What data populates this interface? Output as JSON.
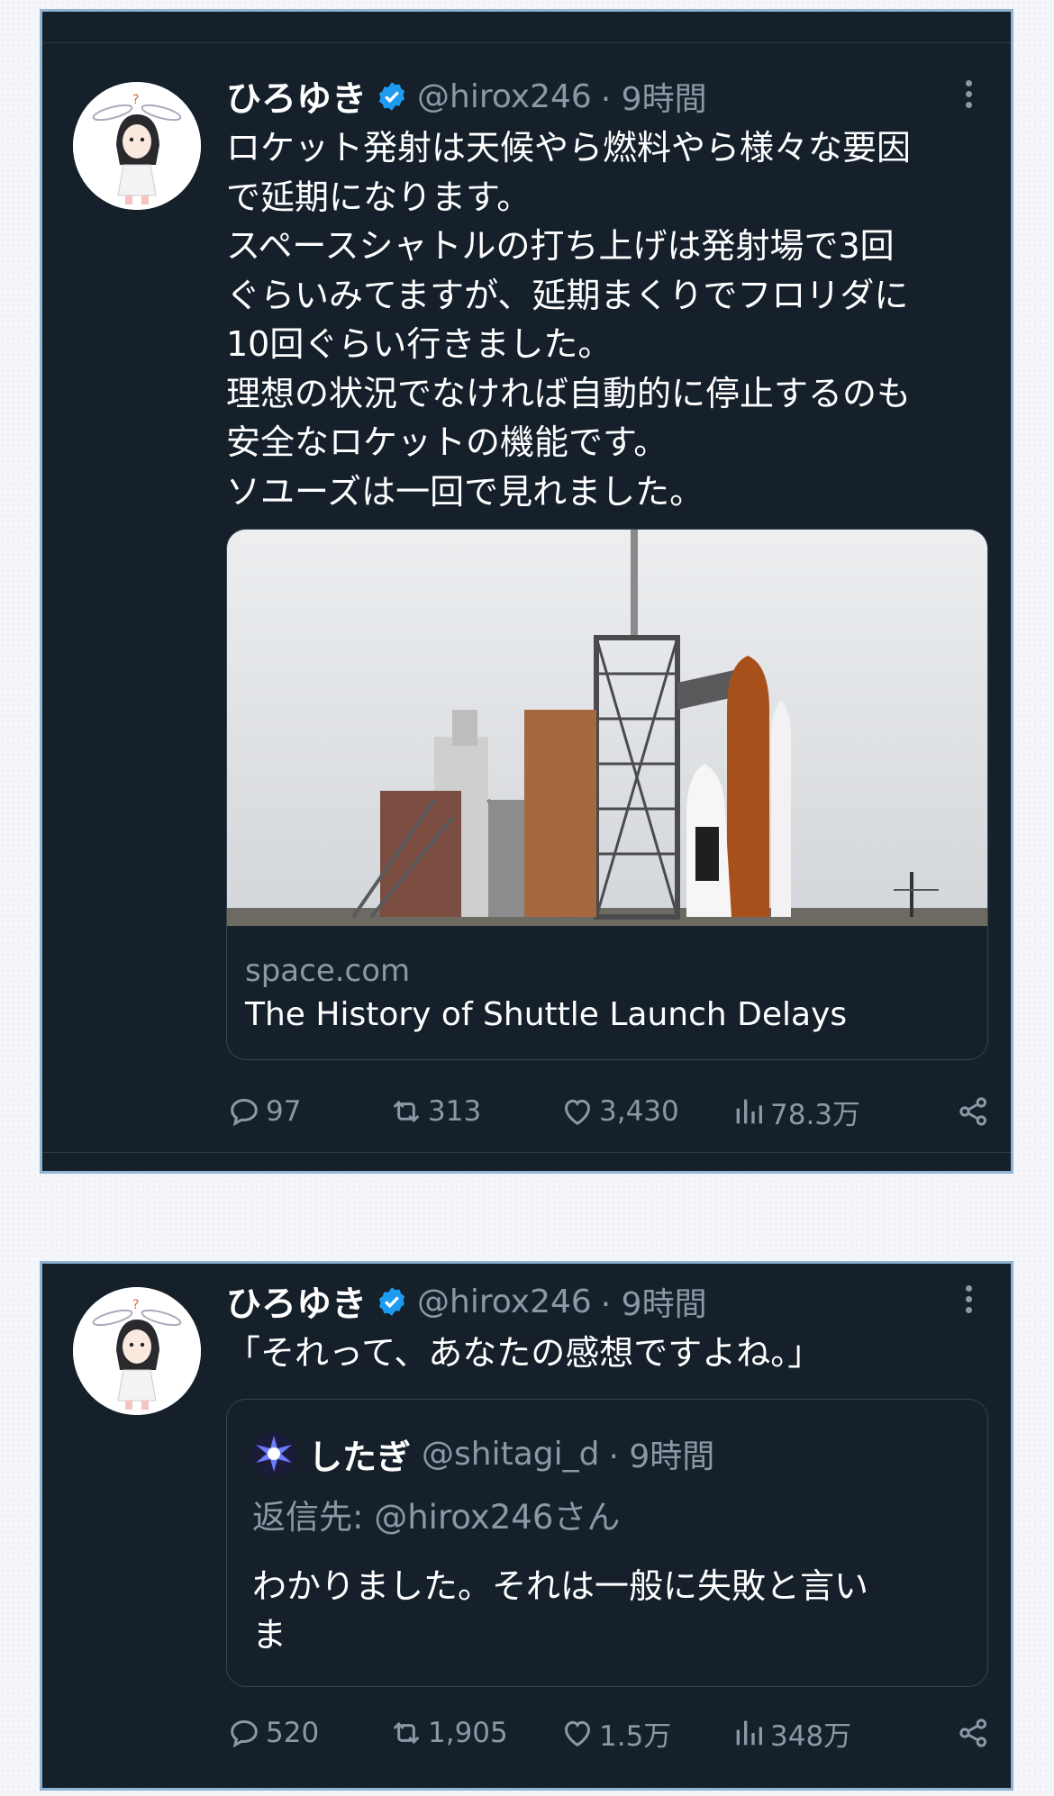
{
  "tweets": [
    {
      "author": {
        "name": "ひろゆき",
        "handle": "@hirox246",
        "time": "· 9時間"
      },
      "text_lines": [
        "ロケット発射は天候やら燃料やら様々な要因",
        "で延期になります。",
        "スペースシャトルの打ち上げは発射場で3回",
        "ぐらいみてますが、延期まくりでフロリダに",
        "10回ぐらい行きました。",
        "理想の状況でなければ自動的に停止するのも",
        "安全なロケットの機能です。",
        "ソユーズは一回で見れました。"
      ],
      "link_card": {
        "domain": "space.com",
        "title": "The History of Shuttle Launch Delays"
      },
      "stats": {
        "replies": "97",
        "retweets": "313",
        "likes": "3,430",
        "views": "78.3万"
      }
    },
    {
      "author": {
        "name": "ひろゆき",
        "handle": "@hirox246",
        "time": "· 9時間"
      },
      "text_lines": [
        "「それって、あなたの感想ですよね。」"
      ],
      "quote": {
        "name": "したぎ",
        "handle": "@shitagi_d",
        "time": "· 9時間",
        "reply_to": "返信先: @hirox246さん",
        "text_lines": [
          "わかりました。それは一般に失敗と言い",
          "ま"
        ]
      },
      "stats": {
        "replies": "520",
        "retweets": "1,905",
        "likes": "1.5万",
        "views": "348万"
      }
    }
  ],
  "icons": {
    "verified": "verified-badge-icon",
    "reply": "reply-icon",
    "retweet": "retweet-icon",
    "like": "heart-icon",
    "views": "views-chart-icon",
    "share": "share-icon",
    "more": "more-dots-icon"
  },
  "colors": {
    "card_bg": "#15202b",
    "card_border": "#8fb4d3",
    "text": "#ffffff",
    "secondary": "#8b98a5",
    "verified": "#1d9bf0"
  }
}
